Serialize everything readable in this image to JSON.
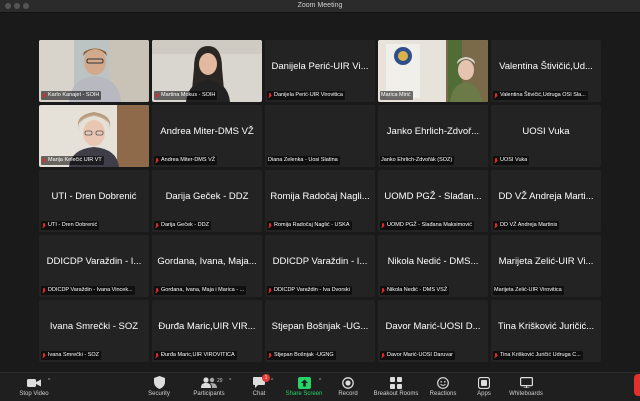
{
  "window": {
    "title": "Zoom Meeting"
  },
  "tiles": [
    {
      "id": "t1",
      "big": "",
      "label": "Karlo Kanajet - SOIH",
      "video": true
    },
    {
      "id": "t2",
      "big": "",
      "label": "Martina Mokus - SOIH",
      "video": true
    },
    {
      "id": "t3",
      "big": "Danijela Perić-UIR Vi...",
      "label": "Danijela Perić-UIR Virovitica"
    },
    {
      "id": "t4",
      "big": "",
      "label": "Marica Mirić",
      "video": true,
      "active": true,
      "mic_on": true
    },
    {
      "id": "t5",
      "big": "Valentina Štivičić,Ud...",
      "label": "Valentina Štivičić,Udruga OSI Sla..."
    },
    {
      "id": "t6",
      "big": "",
      "label": "Marija Kelečić UIR VT",
      "video": true
    },
    {
      "id": "t7",
      "big": "Andrea Miter-DMS VŽ",
      "label": "Andrea Miter-DMS VŽ"
    },
    {
      "id": "t8",
      "big": "",
      "label": "Diana Zelenka - Uosi Slatina",
      "mic_on": true
    },
    {
      "id": "t9",
      "big": "Janko Ehrlich-Zdvoř...",
      "label": "Janko Ehrlich-Zdvořák (SOZ)",
      "mic_on": true
    },
    {
      "id": "t10",
      "big": "UOSI Vuka",
      "label": "UOSI Vuka"
    },
    {
      "id": "t11",
      "big": "UTI - Dren Dobrenić",
      "label": "UTI - Dren Dobrenić"
    },
    {
      "id": "t12",
      "big": "Darija Geček - DDZ",
      "label": "Darija Geček - DDZ"
    },
    {
      "id": "t13",
      "big": "Romija Radočaj Nagli...",
      "label": "Romija Radočaj Naglić - USKA"
    },
    {
      "id": "t14",
      "big": "UOMD PGŽ - Slađan...",
      "label": "UOMD PGŽ - Slađana Maksimović"
    },
    {
      "id": "t15",
      "big": "DD VŽ Andreja Marti...",
      "label": "DD VŽ Andreja Martinis"
    },
    {
      "id": "t16",
      "big": "DDICDP Varaždin - I...",
      "label": "DDICDP Varaždin - Ivana Vincek..."
    },
    {
      "id": "t17",
      "big": "Gordana, Ivana, Maja...",
      "label": "Gordana, Ivana, Maja i Marica - ..."
    },
    {
      "id": "t18",
      "big": "DDICDP Varaždin - I...",
      "label": "DDICDP Varaždin - Iva Dvorski"
    },
    {
      "id": "t19",
      "big": "Nikola Nedić - DMS...",
      "label": "Nikola Nedić - DMS VSŽ"
    },
    {
      "id": "t20",
      "big": "Marijeta Zelić-UIR Vi...",
      "label": "Marijeta Zelić-UIR Virovitica",
      "mic_on": true
    },
    {
      "id": "t21",
      "big": "Ivana Smrečki - SOZ",
      "label": "Ivana Smrečki - SOZ"
    },
    {
      "id": "t22",
      "big": "Đurđa Maric,UIR VIR...",
      "label": "Đurđa Maric,UIR VIROVITICA"
    },
    {
      "id": "t23",
      "big": "Stjepan Bošnjak -UG...",
      "label": "Stjepan Bošnjak -UGNG"
    },
    {
      "id": "t24",
      "big": "Davor Marić-UOSI D...",
      "label": "Davor Marić-UOSI Daruvar"
    },
    {
      "id": "t25",
      "big": "Tina Krišković Juričić...",
      "label": "Tina Krišković Juričić  Udruga C..."
    }
  ],
  "toolbar": {
    "stop_video": "Stop Video",
    "security": "Security",
    "participants": "Participants",
    "participants_count": "29",
    "chat": "Chat",
    "chat_badge": "1",
    "share_screen": "Share Screen",
    "record": "Record",
    "breakout_rooms": "Breakout Rooms",
    "reactions": "Reactions",
    "apps": "Apps",
    "whiteboards": "Whiteboards"
  },
  "colors": {
    "accent_green": "#25d366",
    "mic_muted": "#e02828",
    "end_red": "#e0312c"
  }
}
